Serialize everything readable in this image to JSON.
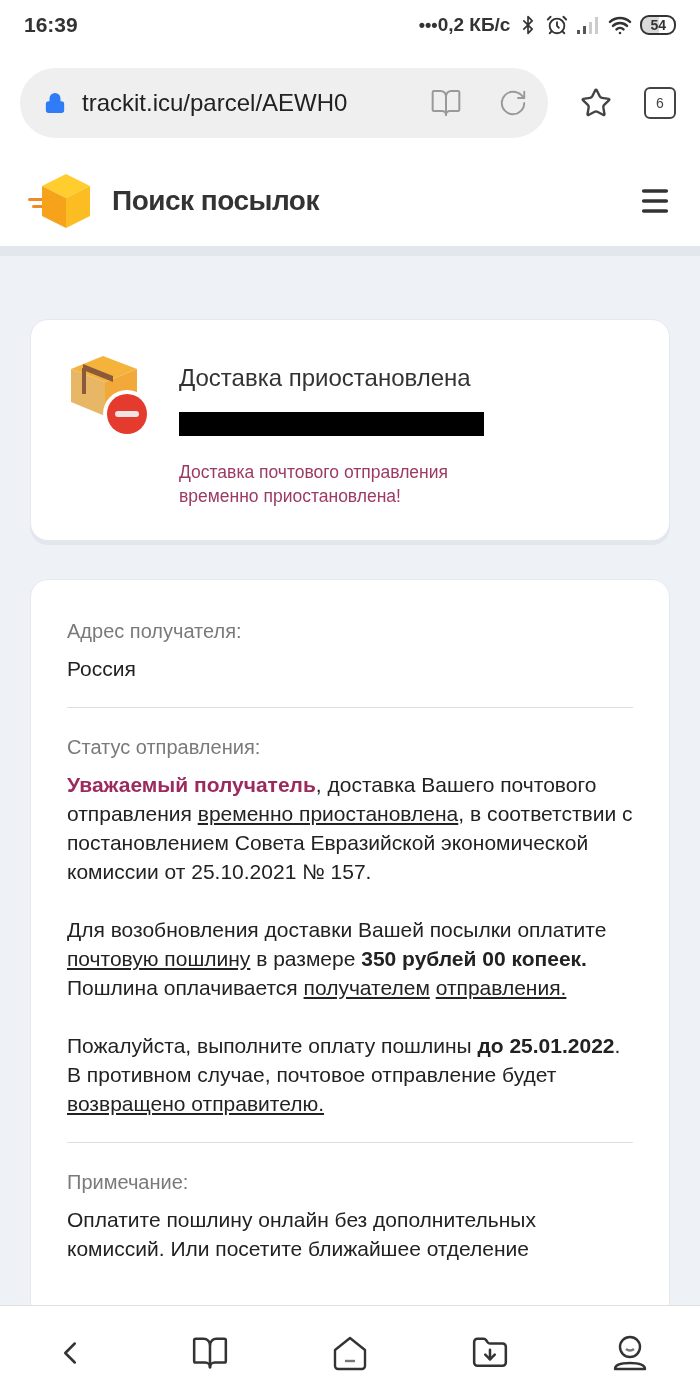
{
  "status_bar": {
    "time": "16:39",
    "dots": "•••",
    "speed": "0,2 КБ/с",
    "battery": "54"
  },
  "browser": {
    "url": "trackit.icu/parcel/AEWH0",
    "tab_count": "6"
  },
  "site": {
    "title": "Поиск посылок"
  },
  "status_card": {
    "title": "Доставка приостановлена",
    "tracking_redacted": true,
    "message": "Доставка почтового отправления временно приостановлена!"
  },
  "details": [
    {
      "label": "Адрес получателя:",
      "paragraphs": [
        [
          {
            "kind": "plain",
            "text": "Россия"
          }
        ]
      ]
    },
    {
      "label": "Статус отправления:",
      "paragraphs": [
        [
          {
            "kind": "accent",
            "text": "Уважаемый получатель"
          },
          {
            "kind": "plain",
            "text": ", доставка Вашего почтового отправления "
          },
          {
            "kind": "link",
            "text": "временно приостановлена"
          },
          {
            "kind": "plain",
            "text": ", в соответствии с постановлением Совета Евразийской экономической комиссии от 25.10.2021 № 157."
          }
        ],
        [
          {
            "kind": "plain",
            "text": "Для возобновления доставки Вашей посылки оплатите "
          },
          {
            "kind": "link",
            "text": "почтовую пошлину"
          },
          {
            "kind": "plain",
            "text": " в размере "
          },
          {
            "kind": "bold",
            "text": "350 рублей 00 копеек."
          },
          {
            "kind": "plain",
            "text": " Пошлина оплачивается "
          },
          {
            "kind": "link",
            "text": "получателем"
          },
          {
            "kind": "link_spaced",
            "text": "отправления."
          }
        ],
        [
          {
            "kind": "plain",
            "text": "Пожалуйста, выполните оплату пошлины "
          },
          {
            "kind": "bold",
            "text": "до 25.01.2022"
          },
          {
            "kind": "plain",
            "text": ". В противном случае, почтовое отправление будет "
          },
          {
            "kind": "link",
            "text": "возвращено отправителю."
          }
        ]
      ]
    },
    {
      "label": "Примечание:",
      "paragraphs": [
        [
          {
            "kind": "plain",
            "text": "Оплатите пошлину онлайн без дополнительных комиссий. Или посетите ближайшее отделение"
          }
        ]
      ]
    }
  ]
}
